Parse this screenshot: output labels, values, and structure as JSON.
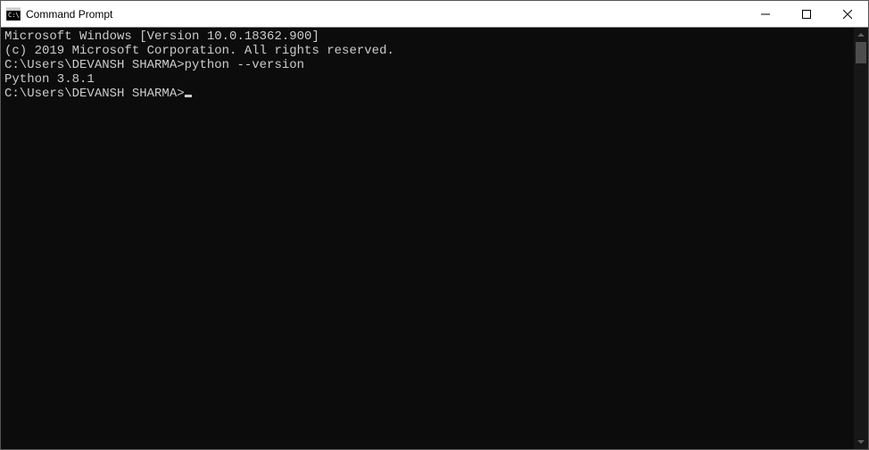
{
  "window": {
    "title": "Command Prompt"
  },
  "terminal": {
    "line1": "Microsoft Windows [Version 10.0.18362.900]",
    "line2": "(c) 2019 Microsoft Corporation. All rights reserved.",
    "blank1": "",
    "prompt1": "C:\\Users\\DEVANSH SHARMA>",
    "command1": "python --version",
    "output1": "Python 3.8.1",
    "blank2": "",
    "prompt2": "C:\\Users\\DEVANSH SHARMA>"
  }
}
